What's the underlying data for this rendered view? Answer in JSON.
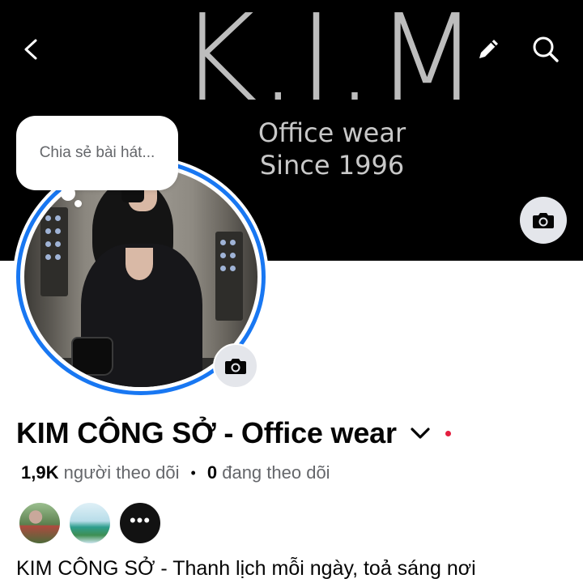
{
  "cover": {
    "logo_text": "K.I.M",
    "subtitle_line1": "Office wear",
    "subtitle_line2": "Since 1996"
  },
  "top_bar": {
    "back_icon": "chevron-left-icon",
    "edit_icon": "pencil-icon",
    "search_icon": "search-icon"
  },
  "music_bubble": {
    "placeholder": "Chia sẻ bài hát..."
  },
  "profile": {
    "name": "KIM CÔNG SỞ - Office wear",
    "followers_count": "1,9K",
    "followers_label": "người theo dõi",
    "separator": "•",
    "following_count": "0",
    "following_label": "đang theo dõi",
    "bio": "KIM CÔNG SỞ - Thanh lịch mỗi ngày, toả sáng nơi"
  },
  "follower_avatars": {
    "more_label": "•••"
  },
  "colors": {
    "accent_blue": "#1877f2",
    "cover_bg": "#000000",
    "secondary_text": "#65676b",
    "notification_red": "#e41e3f",
    "button_gray": "#e4e6eb"
  }
}
